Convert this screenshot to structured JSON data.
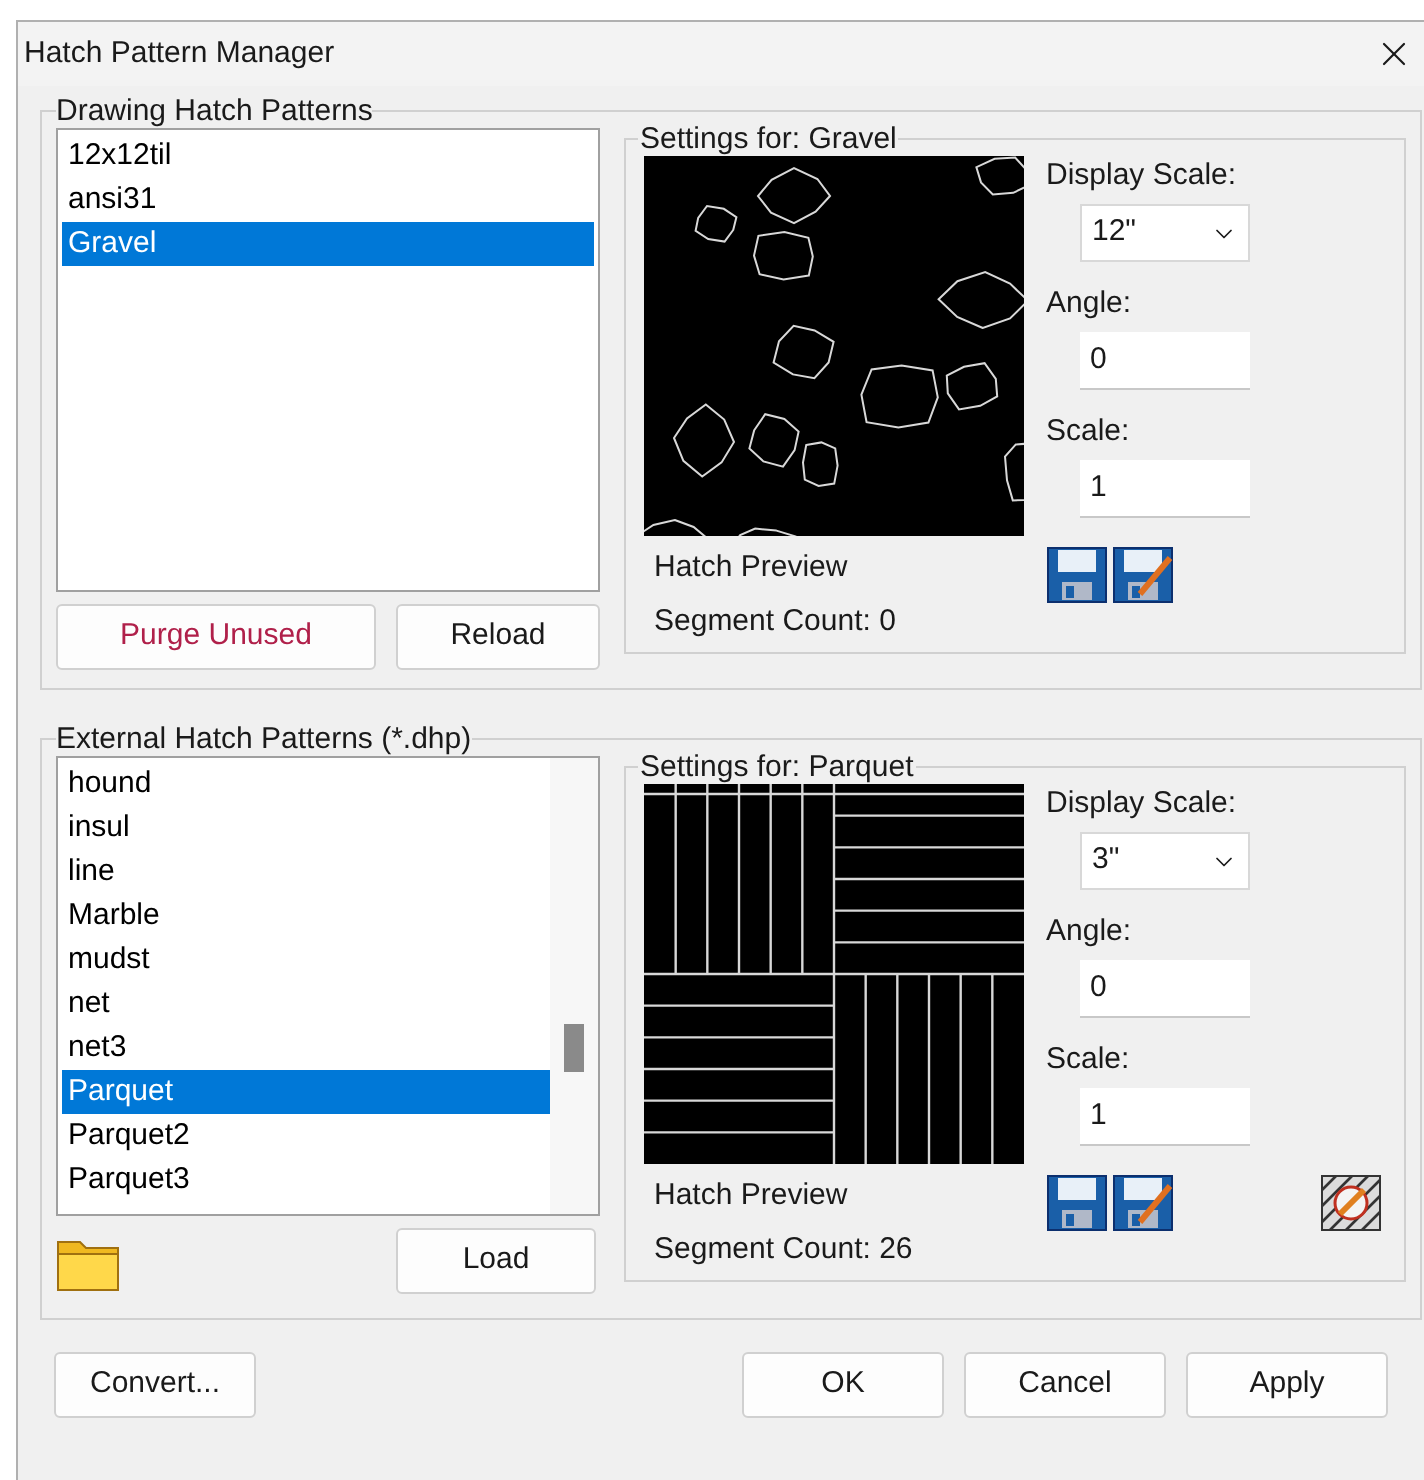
{
  "window": {
    "title": "Hatch Pattern Manager"
  },
  "drawing_patterns": {
    "legend": "Drawing Hatch Patterns",
    "items": [
      {
        "label": "12x12til",
        "selected": false
      },
      {
        "label": "ansi31",
        "selected": false
      },
      {
        "label": "Gravel",
        "selected": true
      }
    ],
    "buttons": [
      {
        "label": "Purge Unused",
        "focused": true
      },
      {
        "label": "Reload",
        "focused": false
      }
    ],
    "settings": {
      "legend": "Settings for: Gravel",
      "kind": "gravel",
      "display_scale_label": "Display Scale:",
      "display_scale": "12\"",
      "angle_label": "Angle:",
      "angle": "0",
      "scale_label": "Scale:",
      "scale": "1",
      "preview_label": "Hatch Preview",
      "segment_count": "Segment Count: 0",
      "edit_tool": false
    }
  },
  "external_patterns": {
    "legend": "External Hatch Patterns (*.dhp)",
    "items": [
      {
        "label": "hound",
        "selected": false
      },
      {
        "label": "insul",
        "selected": false
      },
      {
        "label": "line",
        "selected": false
      },
      {
        "label": "Marble",
        "selected": false
      },
      {
        "label": "mudst",
        "selected": false
      },
      {
        "label": "net",
        "selected": false
      },
      {
        "label": "net3",
        "selected": false
      },
      {
        "label": "Parquet",
        "selected": true
      },
      {
        "label": "Parquet2",
        "selected": false
      },
      {
        "label": "Parquet3",
        "selected": false
      }
    ],
    "load_button": "Load",
    "settings": {
      "legend": "Settings for: Parquet",
      "kind": "parquet",
      "display_scale_label": "Display Scale:",
      "display_scale": "3\"",
      "angle_label": "Angle:",
      "angle": "0",
      "scale_label": "Scale:",
      "scale": "1",
      "preview_label": "Hatch Preview",
      "segment_count": "Segment Count: 26",
      "edit_tool": true
    }
  },
  "footer_buttons": [
    {
      "label": "Convert..."
    },
    {
      "label": "OK"
    },
    {
      "label": "Cancel"
    },
    {
      "label": "Apply"
    }
  ]
}
